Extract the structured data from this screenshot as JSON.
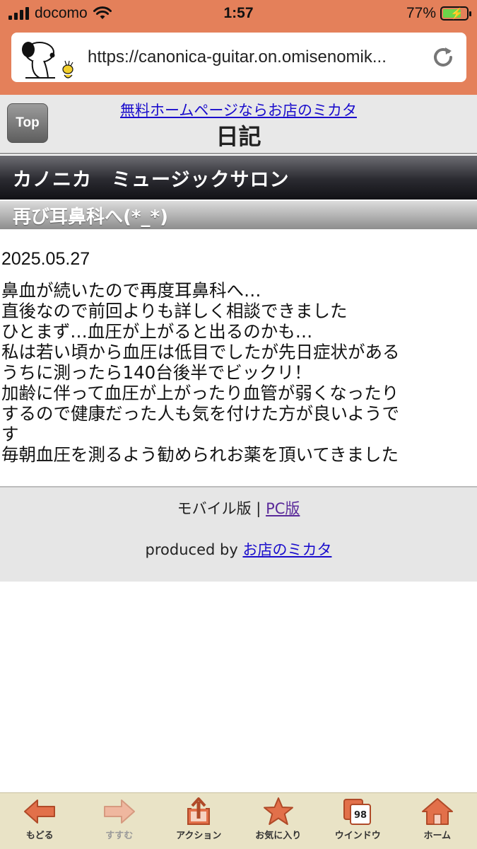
{
  "status": {
    "carrier": "docomo",
    "time": "1:57",
    "battery_percent": "77%",
    "battery_level": 0.77
  },
  "browser": {
    "url": "https://canonica-guitar.on.omisenomik...",
    "reload_icon": "reload-icon",
    "logo_icon": "snoopy-logo"
  },
  "header": {
    "top_button": "Top",
    "ad_link": "無料ホームページならお店のミカタ",
    "title": "日記"
  },
  "site": {
    "name": "カノニカ　ミュージックサロン"
  },
  "article": {
    "title": "再び耳鼻科へ(*_*)",
    "date": "2025.05.27",
    "lines": [
      "鼻血が続いたので再度耳鼻科へ…",
      "直後なので前回よりも詳しく相談できました",
      "ひとまず…血圧が上がると出るのかも…",
      "私は若い頃から血圧は低目でしたが先日症状がある",
      "うちに測ったら140台後半でビックリ！",
      "加齢に伴って血圧が上がったり血管が弱くなったり",
      "するので健康だった人も気を付けた方が良いようで",
      "す",
      "毎朝血圧を測るよう勧められお薬を頂いてきました"
    ]
  },
  "footer": {
    "mobile_label": "モバイル版",
    "separator": "|",
    "pc_link": "PC版",
    "produced_by": "produced by",
    "producer_link": "お店のミカタ"
  },
  "toolbar": {
    "back": "もどる",
    "forward": "すすむ",
    "action": "アクション",
    "favorites": "お気に入り",
    "windows": "ウインドウ",
    "window_count": "98",
    "home": "ホーム"
  },
  "colors": {
    "chrome": "#e4805a",
    "link": "#1a0dcc",
    "toolbar_icon": "#e2704a"
  }
}
